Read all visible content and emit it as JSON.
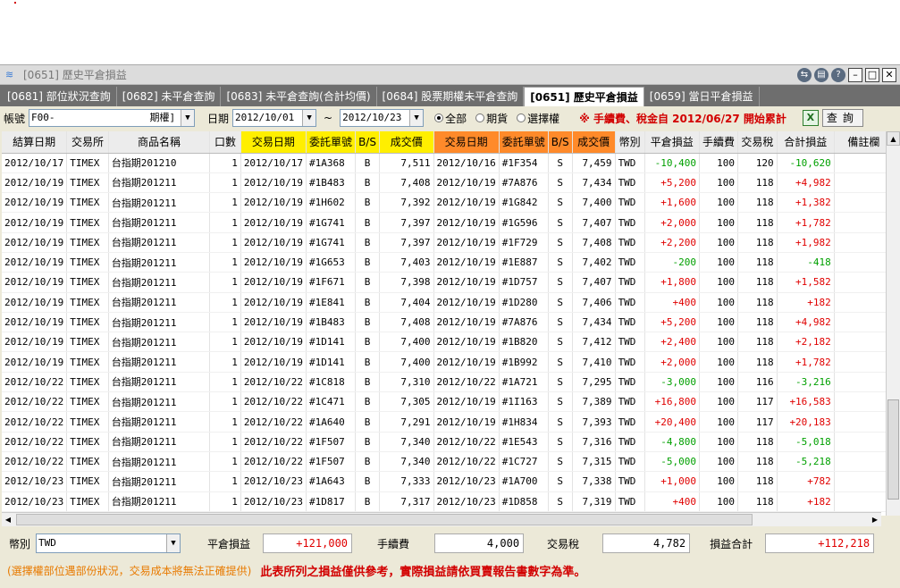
{
  "window": {
    "title": "[0651] 歷史平倉損益"
  },
  "tabs": [
    {
      "label": "[0681] 部位狀況查詢",
      "active": false
    },
    {
      "label": "[0682] 未平倉查詢",
      "active": false
    },
    {
      "label": "[0683] 未平倉查詢(合計均價)",
      "active": false
    },
    {
      "label": "[0684] 股票期權未平倉查詢",
      "active": false
    },
    {
      "label": "[0651] 歷史平倉損益",
      "active": true
    },
    {
      "label": "[0659] 當日平倉損益",
      "active": false
    }
  ],
  "toolbar": {
    "account_label": "帳號",
    "account_value": "F00-                期權]",
    "date_label": "日期",
    "date_from": "2012/10/01",
    "tilde": "~",
    "date_to": "2012/10/23",
    "radio_all": "全部",
    "radio_futures": "期貨",
    "radio_options": "選擇權",
    "selected_radio": "全部",
    "notice": "※ 手續費、稅金自 2012/06/27 開始累計",
    "excel_icon_text": "X",
    "query_button": "查詢"
  },
  "table": {
    "columns": [
      "結算日期",
      "交易所",
      "商品名稱",
      "口數",
      "交易日期",
      "委託單號",
      "B/S",
      "成交價",
      "交易日期",
      "委託單號",
      "B/S",
      "成交價",
      "幣別",
      "平倉損益",
      "手續費",
      "交易稅",
      "合計損益",
      "備註欄"
    ],
    "rows": [
      [
        "2012/10/17",
        "TIMEX",
        "台指期201210",
        "1",
        "2012/10/17",
        "#1A368",
        "B",
        "7,511",
        "2012/10/16",
        "#1F354",
        "S",
        "7,459",
        "TWD",
        "-10,400",
        "100",
        "120",
        "-10,620",
        ""
      ],
      [
        "2012/10/19",
        "TIMEX",
        "台指期201211",
        "1",
        "2012/10/19",
        "#1B483",
        "B",
        "7,408",
        "2012/10/19",
        "#7A876",
        "S",
        "7,434",
        "TWD",
        "+5,200",
        "100",
        "118",
        "+4,982",
        ""
      ],
      [
        "2012/10/19",
        "TIMEX",
        "台指期201211",
        "1",
        "2012/10/19",
        "#1H602",
        "B",
        "7,392",
        "2012/10/19",
        "#1G842",
        "S",
        "7,400",
        "TWD",
        "+1,600",
        "100",
        "118",
        "+1,382",
        ""
      ],
      [
        "2012/10/19",
        "TIMEX",
        "台指期201211",
        "1",
        "2012/10/19",
        "#1G741",
        "B",
        "7,397",
        "2012/10/19",
        "#1G596",
        "S",
        "7,407",
        "TWD",
        "+2,000",
        "100",
        "118",
        "+1,782",
        ""
      ],
      [
        "2012/10/19",
        "TIMEX",
        "台指期201211",
        "1",
        "2012/10/19",
        "#1G741",
        "B",
        "7,397",
        "2012/10/19",
        "#1F729",
        "S",
        "7,408",
        "TWD",
        "+2,200",
        "100",
        "118",
        "+1,982",
        ""
      ],
      [
        "2012/10/19",
        "TIMEX",
        "台指期201211",
        "1",
        "2012/10/19",
        "#1G653",
        "B",
        "7,403",
        "2012/10/19",
        "#1E887",
        "S",
        "7,402",
        "TWD",
        "-200",
        "100",
        "118",
        "-418",
        ""
      ],
      [
        "2012/10/19",
        "TIMEX",
        "台指期201211",
        "1",
        "2012/10/19",
        "#1F671",
        "B",
        "7,398",
        "2012/10/19",
        "#1D757",
        "S",
        "7,407",
        "TWD",
        "+1,800",
        "100",
        "118",
        "+1,582",
        ""
      ],
      [
        "2012/10/19",
        "TIMEX",
        "台指期201211",
        "1",
        "2012/10/19",
        "#1E841",
        "B",
        "7,404",
        "2012/10/19",
        "#1D280",
        "S",
        "7,406",
        "TWD",
        "+400",
        "100",
        "118",
        "+182",
        ""
      ],
      [
        "2012/10/19",
        "TIMEX",
        "台指期201211",
        "1",
        "2012/10/19",
        "#1B483",
        "B",
        "7,408",
        "2012/10/19",
        "#7A876",
        "S",
        "7,434",
        "TWD",
        "+5,200",
        "100",
        "118",
        "+4,982",
        ""
      ],
      [
        "2012/10/19",
        "TIMEX",
        "台指期201211",
        "1",
        "2012/10/19",
        "#1D141",
        "B",
        "7,400",
        "2012/10/19",
        "#1B820",
        "S",
        "7,412",
        "TWD",
        "+2,400",
        "100",
        "118",
        "+2,182",
        ""
      ],
      [
        "2012/10/19",
        "TIMEX",
        "台指期201211",
        "1",
        "2012/10/19",
        "#1D141",
        "B",
        "7,400",
        "2012/10/19",
        "#1B992",
        "S",
        "7,410",
        "TWD",
        "+2,000",
        "100",
        "118",
        "+1,782",
        ""
      ],
      [
        "2012/10/22",
        "TIMEX",
        "台指期201211",
        "1",
        "2012/10/22",
        "#1C818",
        "B",
        "7,310",
        "2012/10/22",
        "#1A721",
        "S",
        "7,295",
        "TWD",
        "-3,000",
        "100",
        "116",
        "-3,216",
        ""
      ],
      [
        "2012/10/22",
        "TIMEX",
        "台指期201211",
        "1",
        "2012/10/22",
        "#1C471",
        "B",
        "7,305",
        "2012/10/19",
        "#1I163",
        "S",
        "7,389",
        "TWD",
        "+16,800",
        "100",
        "117",
        "+16,583",
        ""
      ],
      [
        "2012/10/22",
        "TIMEX",
        "台指期201211",
        "1",
        "2012/10/22",
        "#1A640",
        "B",
        "7,291",
        "2012/10/19",
        "#1H834",
        "S",
        "7,393",
        "TWD",
        "+20,400",
        "100",
        "117",
        "+20,183",
        ""
      ],
      [
        "2012/10/22",
        "TIMEX",
        "台指期201211",
        "1",
        "2012/10/22",
        "#1F507",
        "B",
        "7,340",
        "2012/10/22",
        "#1E543",
        "S",
        "7,316",
        "TWD",
        "-4,800",
        "100",
        "118",
        "-5,018",
        ""
      ],
      [
        "2012/10/22",
        "TIMEX",
        "台指期201211",
        "1",
        "2012/10/22",
        "#1F507",
        "B",
        "7,340",
        "2012/10/22",
        "#1C727",
        "S",
        "7,315",
        "TWD",
        "-5,000",
        "100",
        "118",
        "-5,218",
        ""
      ],
      [
        "2012/10/23",
        "TIMEX",
        "台指期201211",
        "1",
        "2012/10/23",
        "#1A643",
        "B",
        "7,333",
        "2012/10/23",
        "#1A700",
        "S",
        "7,338",
        "TWD",
        "+1,000",
        "100",
        "118",
        "+782",
        ""
      ],
      [
        "2012/10/23",
        "TIMEX",
        "台指期201211",
        "1",
        "2012/10/23",
        "#1D817",
        "B",
        "7,317",
        "2012/10/23",
        "#1D858",
        "S",
        "7,319",
        "TWD",
        "+400",
        "100",
        "118",
        "+182",
        ""
      ]
    ]
  },
  "summary": {
    "currency_label": "幣別",
    "currency_value": "TWD",
    "pnl_label": "平倉損益",
    "pnl_value": "+121,000",
    "fee_label": "手續費",
    "fee_value": "4,000",
    "tax_label": "交易稅",
    "tax_value": "4,782",
    "total_label": "損益合計",
    "total_value": "+112,218"
  },
  "footer": {
    "note_options": "(選擇權部位遇部份狀況，交易成本將無法正確提供)",
    "note_disclaimer": "此表所列之損益僅供參考，實際損益請依買賣報告書數字為準。"
  },
  "colors": {
    "positive": "#e00000",
    "negative": "#00a000",
    "header_yellow": "#ffef00",
    "header_orange": "#ff8a2a",
    "notice_red": "#d20000"
  }
}
